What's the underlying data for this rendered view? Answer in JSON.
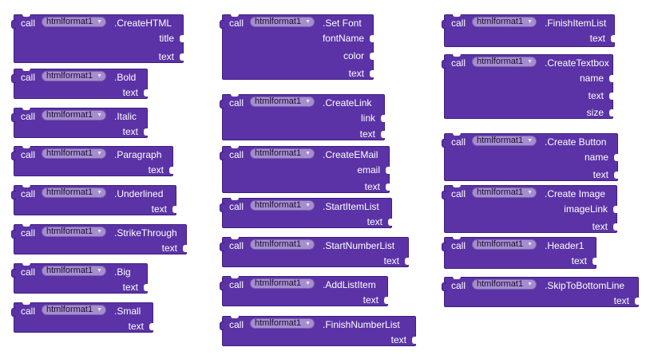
{
  "blocks": [
    {
      "call": "call",
      "component": "htmlformat1",
      "method": ".CreateHTML",
      "params": [
        "title",
        "text"
      ]
    },
    {
      "call": "call",
      "component": "htmlformat1",
      "method": ".Bold",
      "params": [
        "text"
      ]
    },
    {
      "call": "call",
      "component": "htmlformat1",
      "method": ".Italic",
      "params": [
        "text"
      ]
    },
    {
      "call": "call",
      "component": "htmlformat1",
      "method": ".Paragraph",
      "params": [
        "text"
      ]
    },
    {
      "call": "call",
      "component": "htmlformat1",
      "method": ".Underlined",
      "params": [
        "text"
      ]
    },
    {
      "call": "call",
      "component": "htmlformat1",
      "method": ".StrikeThrough",
      "params": [
        "text"
      ]
    },
    {
      "call": "call",
      "component": "htmlformat1",
      "method": ".Big",
      "params": [
        "text"
      ]
    },
    {
      "call": "call",
      "component": "htmlformat1",
      "method": ".Small",
      "params": [
        "text"
      ]
    },
    {
      "call": "call",
      "component": "htmlformat1",
      "method": ".Set Font",
      "params": [
        "fontName",
        "color",
        "text"
      ]
    },
    {
      "call": "call",
      "component": "htmlformat1",
      "method": ".CreateLink",
      "params": [
        "link",
        "text"
      ]
    },
    {
      "call": "call",
      "component": "htmlformat1",
      "method": ".CreateEMail",
      "params": [
        "email",
        "text"
      ]
    },
    {
      "call": "call",
      "component": "htmlformat1",
      "method": ".StartItemList",
      "params": [
        "text"
      ]
    },
    {
      "call": "call",
      "component": "htmlformat1",
      "method": ".StartNumberList",
      "params": [
        "text"
      ]
    },
    {
      "call": "call",
      "component": "htmlformat1",
      "method": ".AddListItem",
      "params": [
        "text"
      ]
    },
    {
      "call": "call",
      "component": "htmlformat1",
      "method": ".FinishNumberList",
      "params": [
        "text"
      ]
    },
    {
      "call": "call",
      "component": "htmlformat1",
      "method": ".FinishItemList",
      "params": [
        "text"
      ]
    },
    {
      "call": "call",
      "component": "htmlformat1",
      "method": ".CreateTextbox",
      "params": [
        "name",
        "text",
        "size"
      ]
    },
    {
      "call": "call",
      "component": "htmlformat1",
      "method": ".Create Button",
      "params": [
        "name",
        "text"
      ]
    },
    {
      "call": "call",
      "component": "htmlformat1",
      "method": ".Create Image",
      "params": [
        "imageLink",
        "text"
      ]
    },
    {
      "call": "call",
      "component": "htmlformat1",
      "method": ".Header1",
      "params": [
        "text"
      ]
    },
    {
      "call": "call",
      "component": "htmlformat1",
      "method": ".SkipToBottomLine",
      "params": [
        "text"
      ]
    }
  ],
  "colors": {
    "block": "#5b33a6",
    "component_pill": "#a58dd0",
    "background": "#ffffff"
  },
  "icons": {
    "dropdown": "dropdown-arrow-icon"
  }
}
